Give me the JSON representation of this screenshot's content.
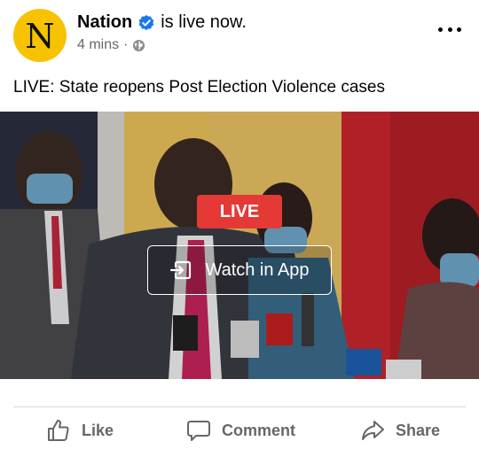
{
  "post": {
    "avatar_letter": "N",
    "author": "Nation",
    "status_text": "is live now.",
    "time": "4 mins",
    "dot": "·",
    "privacy_icon": "globe-icon",
    "text": "LIVE: State reopens Post Election Violence cases"
  },
  "video": {
    "live_label": "LIVE",
    "watch_label": "Watch in App"
  },
  "actions": {
    "like": "Like",
    "comment": "Comment",
    "share": "Share"
  },
  "colors": {
    "avatar_bg": "#f7c300",
    "verified": "#1877f2",
    "live_badge": "#e53935",
    "action_text": "#65676b"
  }
}
